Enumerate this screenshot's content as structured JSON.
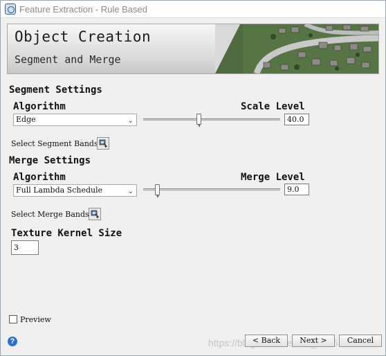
{
  "window": {
    "title": "Feature Extraction - Rule Based"
  },
  "banner": {
    "title": "Object Creation",
    "subtitle": "Segment and Merge"
  },
  "segment": {
    "heading": "Segment Settings",
    "algorithm_label": "Algorithm",
    "algorithm_value": "Edge",
    "scale_label": "Scale Level",
    "scale_value": "40.0",
    "scale_fraction": 0.4,
    "bands_label": "Select Segment Bands"
  },
  "merge": {
    "heading": "Merge Settings",
    "algorithm_label": "Algorithm",
    "algorithm_value": "Full Lambda Schedule",
    "merge_label": "Merge Level",
    "merge_value": "9.0",
    "merge_fraction": 0.09,
    "bands_label": "Select Merge Bands"
  },
  "texture": {
    "label": "Texture Kernel Size",
    "value": "3"
  },
  "preview": {
    "label": "Preview",
    "checked": false
  },
  "buttons": {
    "back": "< Back",
    "next": "Next >",
    "cancel": "Cancel"
  },
  "watermark": "https://blog.csdn.net/m0_46451314"
}
